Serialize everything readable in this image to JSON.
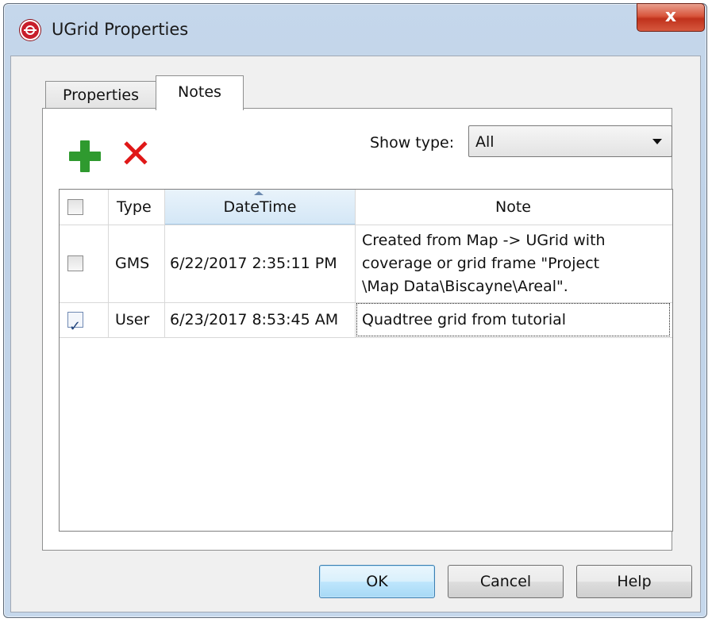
{
  "window": {
    "title": "UGrid Properties",
    "close_glyph": "x"
  },
  "tabs": [
    {
      "label": "Properties",
      "active": false
    },
    {
      "label": "Notes",
      "active": true
    }
  ],
  "toolbar": {
    "add_icon": "green-plus-icon",
    "delete_icon": "red-x-icon",
    "delete_glyph": "✕"
  },
  "filter": {
    "label": "Show type:",
    "value": "All"
  },
  "table": {
    "columns": [
      "",
      "Type",
      "DateTime",
      "Note"
    ],
    "sorted_column": "DateTime",
    "rows": [
      {
        "checked": false,
        "type": "GMS",
        "datetime": "6/22/2017 2:35:11 PM",
        "note_lines": [
          "Created from Map -> UGrid with",
          "coverage or grid frame \"Project",
          "\\Map Data\\Biscayne\\Areal\"."
        ]
      },
      {
        "checked": true,
        "type": "User",
        "datetime": "6/23/2017 8:53:45 AM",
        "note": "Quadtree grid from tutorial"
      }
    ]
  },
  "buttons": {
    "ok": "OK",
    "cancel": "Cancel",
    "help": "Help"
  },
  "colors": {
    "add_icon": "#2f9a2f",
    "delete_icon": "#e01818",
    "close_button": "#c0321c",
    "selected_header": "#d4e7f6"
  }
}
